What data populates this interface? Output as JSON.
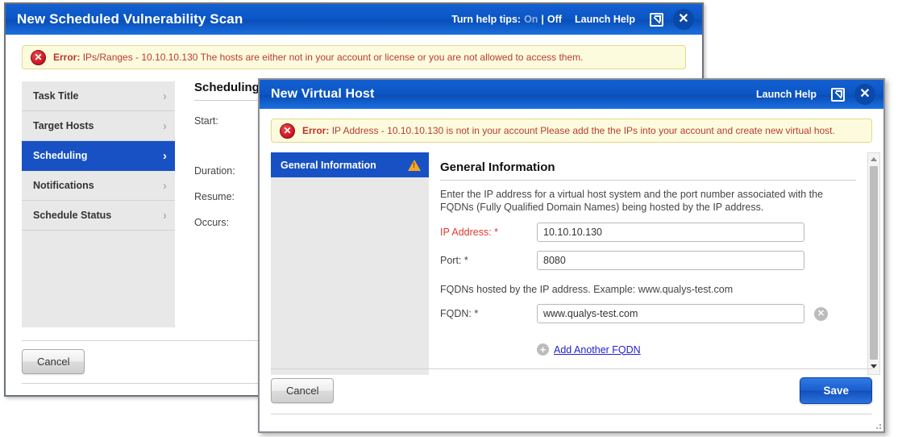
{
  "bg_window": {
    "title": "New Scheduled Vulnerability Scan",
    "help_tips_label": "Turn help tips:",
    "help_tips_on": "On",
    "help_tips_sep": "|",
    "help_tips_off": "Off",
    "launch_help": "Launch Help",
    "expand_icon": "expand-icon",
    "close_icon": "close-icon",
    "error": {
      "icon": "error-icon",
      "prefix": "Error:",
      "message": "IPs/Ranges - 10.10.10.130 The hosts are either not in your account or license or you are not allowed to access them."
    },
    "nav": [
      {
        "label": "Task Title",
        "chevron": "›"
      },
      {
        "label": "Target Hosts",
        "chevron": "›"
      },
      {
        "label": "Scheduling",
        "chevron": "›"
      },
      {
        "label": "Notifications",
        "chevron": "›"
      },
      {
        "label": "Schedule Status",
        "chevron": "›"
      }
    ],
    "panel": {
      "title": "Scheduling",
      "labels": [
        "Start:",
        "Duration:",
        "Resume:",
        "Occurs:"
      ]
    },
    "cancel_label": "Cancel"
  },
  "modal": {
    "title": "New Virtual Host",
    "launch_help": "Launch Help",
    "expand_icon": "expand-icon",
    "close_icon": "close-icon",
    "error": {
      "icon": "error-icon",
      "prefix": "Error:",
      "message": "IP Address - 10.10.10.130 is not in your account Please add the the IPs into your account and create new virtual host."
    },
    "side_tabs": [
      {
        "label": "General Information",
        "warning_icon": "warning-triangle-icon"
      }
    ],
    "form": {
      "title": "General Information",
      "description": "Enter the IP address for a virtual host system and the port number associated with the FQDNs (Fully Qualified Domain Names) being hosted by the IP address.",
      "ip_label": "IP Address: *",
      "ip_value": "10.10.10.130",
      "port_label": "Port: *",
      "port_value": "8080",
      "fqdn_hint": "FQDNs hosted by the IP address. Example: www.qualys-test.com",
      "fqdn_label": "FQDN: *",
      "fqdn_value": "www.qualys-test.com",
      "fqdn_delete_icon": "remove-circle-icon",
      "add_icon": "plus-circle-icon",
      "add_label": "Add Another FQDN"
    },
    "scrollbar": {
      "up_icon": "scroll-up-arrow-icon",
      "down_icon": "scroll-down-arrow-icon"
    },
    "cancel_label": "Cancel",
    "save_label": "Save"
  },
  "colors": {
    "accent_blue": "#1751c4",
    "error_red": "#c0322b",
    "warning_orange": "#f5a623",
    "link_blue": "#2222cc"
  }
}
